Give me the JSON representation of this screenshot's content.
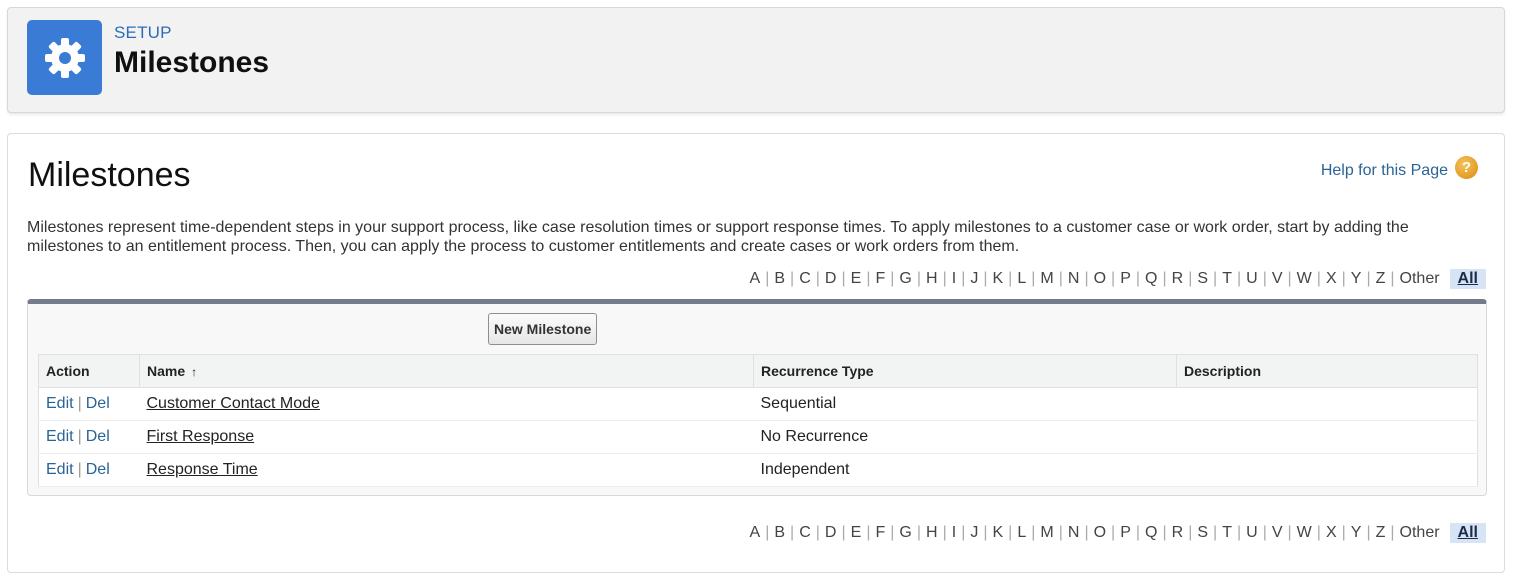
{
  "header": {
    "eyebrow": "SETUP",
    "title": "Milestones",
    "icon": "gear-icon",
    "icon_color": "#3a7bd5"
  },
  "page": {
    "title": "Milestones",
    "help_link": "Help for this Page",
    "help_icon": "?",
    "description": "Milestones represent time-dependent steps in your support process, like case resolution times or support response times. To apply milestones to a customer case or work order, start by adding the milestones to an entitlement process. Then, you can apply the process to customer entitlements and create cases or work orders from them."
  },
  "alpha": {
    "letters": [
      "A",
      "B",
      "C",
      "D",
      "E",
      "F",
      "G",
      "H",
      "I",
      "J",
      "K",
      "L",
      "M",
      "N",
      "O",
      "P",
      "Q",
      "R",
      "S",
      "T",
      "U",
      "V",
      "W",
      "X",
      "Y",
      "Z",
      "Other"
    ],
    "all": "All"
  },
  "list": {
    "new_button": "New Milestone",
    "columns": {
      "action": "Action",
      "name": "Name",
      "sort_arrow": "↑",
      "recurrence": "Recurrence Type",
      "description": "Description"
    },
    "edit_label": "Edit",
    "del_label": "Del",
    "rows": [
      {
        "name": "Customer Contact Mode",
        "recurrence": "Sequential",
        "description": ""
      },
      {
        "name": "First Response",
        "recurrence": "No Recurrence",
        "description": ""
      },
      {
        "name": "Response Time",
        "recurrence": "Independent",
        "description": ""
      }
    ]
  }
}
